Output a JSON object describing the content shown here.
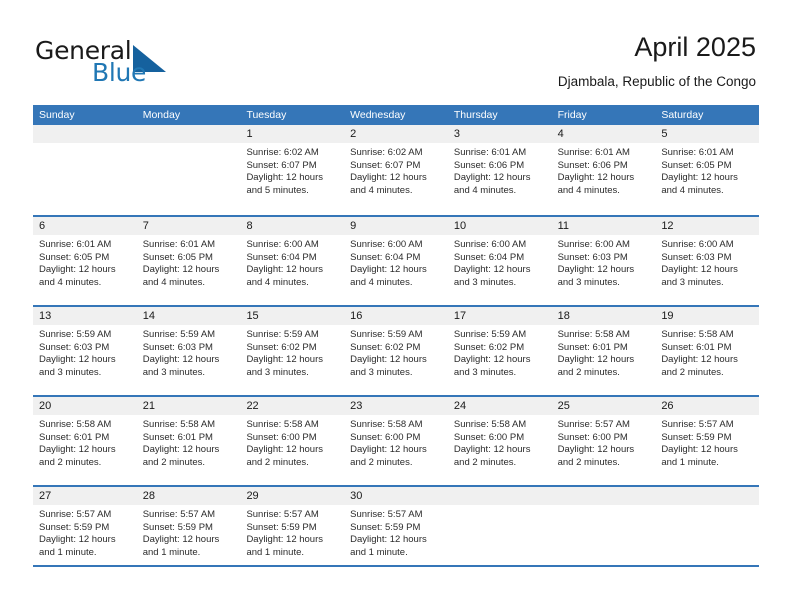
{
  "brand": {
    "name_line1": "General",
    "name_line2": "Blue",
    "accent_color": "#2077b4",
    "triangle_color": "#15619e"
  },
  "header": {
    "title": "April 2025",
    "subtitle": "Djambala, Republic of the Congo"
  },
  "theme": {
    "header_row_bg": "#3576b8",
    "day_number_bg": "#f0f0f0",
    "rule_color": "#3576b8"
  },
  "weekdays": [
    "Sunday",
    "Monday",
    "Tuesday",
    "Wednesday",
    "Thursday",
    "Friday",
    "Saturday"
  ],
  "weeks": [
    [
      {
        "day": "",
        "empty": true,
        "sunrise": "",
        "sunset": "",
        "daylight_a": "",
        "daylight_b": ""
      },
      {
        "day": "",
        "empty": true,
        "sunrise": "",
        "sunset": "",
        "daylight_a": "",
        "daylight_b": ""
      },
      {
        "day": "1",
        "empty": false,
        "sunrise": "Sunrise: 6:02 AM",
        "sunset": "Sunset: 6:07 PM",
        "daylight_a": "Daylight: 12 hours",
        "daylight_b": "and 5 minutes."
      },
      {
        "day": "2",
        "empty": false,
        "sunrise": "Sunrise: 6:02 AM",
        "sunset": "Sunset: 6:07 PM",
        "daylight_a": "Daylight: 12 hours",
        "daylight_b": "and 4 minutes."
      },
      {
        "day": "3",
        "empty": false,
        "sunrise": "Sunrise: 6:01 AM",
        "sunset": "Sunset: 6:06 PM",
        "daylight_a": "Daylight: 12 hours",
        "daylight_b": "and 4 minutes."
      },
      {
        "day": "4",
        "empty": false,
        "sunrise": "Sunrise: 6:01 AM",
        "sunset": "Sunset: 6:06 PM",
        "daylight_a": "Daylight: 12 hours",
        "daylight_b": "and 4 minutes."
      },
      {
        "day": "5",
        "empty": false,
        "sunrise": "Sunrise: 6:01 AM",
        "sunset": "Sunset: 6:05 PM",
        "daylight_a": "Daylight: 12 hours",
        "daylight_b": "and 4 minutes."
      }
    ],
    [
      {
        "day": "6",
        "empty": false,
        "sunrise": "Sunrise: 6:01 AM",
        "sunset": "Sunset: 6:05 PM",
        "daylight_a": "Daylight: 12 hours",
        "daylight_b": "and 4 minutes."
      },
      {
        "day": "7",
        "empty": false,
        "sunrise": "Sunrise: 6:01 AM",
        "sunset": "Sunset: 6:05 PM",
        "daylight_a": "Daylight: 12 hours",
        "daylight_b": "and 4 minutes."
      },
      {
        "day": "8",
        "empty": false,
        "sunrise": "Sunrise: 6:00 AM",
        "sunset": "Sunset: 6:04 PM",
        "daylight_a": "Daylight: 12 hours",
        "daylight_b": "and 4 minutes."
      },
      {
        "day": "9",
        "empty": false,
        "sunrise": "Sunrise: 6:00 AM",
        "sunset": "Sunset: 6:04 PM",
        "daylight_a": "Daylight: 12 hours",
        "daylight_b": "and 4 minutes."
      },
      {
        "day": "10",
        "empty": false,
        "sunrise": "Sunrise: 6:00 AM",
        "sunset": "Sunset: 6:04 PM",
        "daylight_a": "Daylight: 12 hours",
        "daylight_b": "and 3 minutes."
      },
      {
        "day": "11",
        "empty": false,
        "sunrise": "Sunrise: 6:00 AM",
        "sunset": "Sunset: 6:03 PM",
        "daylight_a": "Daylight: 12 hours",
        "daylight_b": "and 3 minutes."
      },
      {
        "day": "12",
        "empty": false,
        "sunrise": "Sunrise: 6:00 AM",
        "sunset": "Sunset: 6:03 PM",
        "daylight_a": "Daylight: 12 hours",
        "daylight_b": "and 3 minutes."
      }
    ],
    [
      {
        "day": "13",
        "empty": false,
        "sunrise": "Sunrise: 5:59 AM",
        "sunset": "Sunset: 6:03 PM",
        "daylight_a": "Daylight: 12 hours",
        "daylight_b": "and 3 minutes."
      },
      {
        "day": "14",
        "empty": false,
        "sunrise": "Sunrise: 5:59 AM",
        "sunset": "Sunset: 6:03 PM",
        "daylight_a": "Daylight: 12 hours",
        "daylight_b": "and 3 minutes."
      },
      {
        "day": "15",
        "empty": false,
        "sunrise": "Sunrise: 5:59 AM",
        "sunset": "Sunset: 6:02 PM",
        "daylight_a": "Daylight: 12 hours",
        "daylight_b": "and 3 minutes."
      },
      {
        "day": "16",
        "empty": false,
        "sunrise": "Sunrise: 5:59 AM",
        "sunset": "Sunset: 6:02 PM",
        "daylight_a": "Daylight: 12 hours",
        "daylight_b": "and 3 minutes."
      },
      {
        "day": "17",
        "empty": false,
        "sunrise": "Sunrise: 5:59 AM",
        "sunset": "Sunset: 6:02 PM",
        "daylight_a": "Daylight: 12 hours",
        "daylight_b": "and 3 minutes."
      },
      {
        "day": "18",
        "empty": false,
        "sunrise": "Sunrise: 5:58 AM",
        "sunset": "Sunset: 6:01 PM",
        "daylight_a": "Daylight: 12 hours",
        "daylight_b": "and 2 minutes."
      },
      {
        "day": "19",
        "empty": false,
        "sunrise": "Sunrise: 5:58 AM",
        "sunset": "Sunset: 6:01 PM",
        "daylight_a": "Daylight: 12 hours",
        "daylight_b": "and 2 minutes."
      }
    ],
    [
      {
        "day": "20",
        "empty": false,
        "sunrise": "Sunrise: 5:58 AM",
        "sunset": "Sunset: 6:01 PM",
        "daylight_a": "Daylight: 12 hours",
        "daylight_b": "and 2 minutes."
      },
      {
        "day": "21",
        "empty": false,
        "sunrise": "Sunrise: 5:58 AM",
        "sunset": "Sunset: 6:01 PM",
        "daylight_a": "Daylight: 12 hours",
        "daylight_b": "and 2 minutes."
      },
      {
        "day": "22",
        "empty": false,
        "sunrise": "Sunrise: 5:58 AM",
        "sunset": "Sunset: 6:00 PM",
        "daylight_a": "Daylight: 12 hours",
        "daylight_b": "and 2 minutes."
      },
      {
        "day": "23",
        "empty": false,
        "sunrise": "Sunrise: 5:58 AM",
        "sunset": "Sunset: 6:00 PM",
        "daylight_a": "Daylight: 12 hours",
        "daylight_b": "and 2 minutes."
      },
      {
        "day": "24",
        "empty": false,
        "sunrise": "Sunrise: 5:58 AM",
        "sunset": "Sunset: 6:00 PM",
        "daylight_a": "Daylight: 12 hours",
        "daylight_b": "and 2 minutes."
      },
      {
        "day": "25",
        "empty": false,
        "sunrise": "Sunrise: 5:57 AM",
        "sunset": "Sunset: 6:00 PM",
        "daylight_a": "Daylight: 12 hours",
        "daylight_b": "and 2 minutes."
      },
      {
        "day": "26",
        "empty": false,
        "sunrise": "Sunrise: 5:57 AM",
        "sunset": "Sunset: 5:59 PM",
        "daylight_a": "Daylight: 12 hours",
        "daylight_b": "and 1 minute."
      }
    ],
    [
      {
        "day": "27",
        "empty": false,
        "sunrise": "Sunrise: 5:57 AM",
        "sunset": "Sunset: 5:59 PM",
        "daylight_a": "Daylight: 12 hours",
        "daylight_b": "and 1 minute."
      },
      {
        "day": "28",
        "empty": false,
        "sunrise": "Sunrise: 5:57 AM",
        "sunset": "Sunset: 5:59 PM",
        "daylight_a": "Daylight: 12 hours",
        "daylight_b": "and 1 minute."
      },
      {
        "day": "29",
        "empty": false,
        "sunrise": "Sunrise: 5:57 AM",
        "sunset": "Sunset: 5:59 PM",
        "daylight_a": "Daylight: 12 hours",
        "daylight_b": "and 1 minute."
      },
      {
        "day": "30",
        "empty": false,
        "sunrise": "Sunrise: 5:57 AM",
        "sunset": "Sunset: 5:59 PM",
        "daylight_a": "Daylight: 12 hours",
        "daylight_b": "and 1 minute."
      },
      {
        "day": "",
        "empty": true,
        "sunrise": "",
        "sunset": "",
        "daylight_a": "",
        "daylight_b": ""
      },
      {
        "day": "",
        "empty": true,
        "sunrise": "",
        "sunset": "",
        "daylight_a": "",
        "daylight_b": ""
      },
      {
        "day": "",
        "empty": true,
        "sunrise": "",
        "sunset": "",
        "daylight_a": "",
        "daylight_b": ""
      }
    ]
  ]
}
